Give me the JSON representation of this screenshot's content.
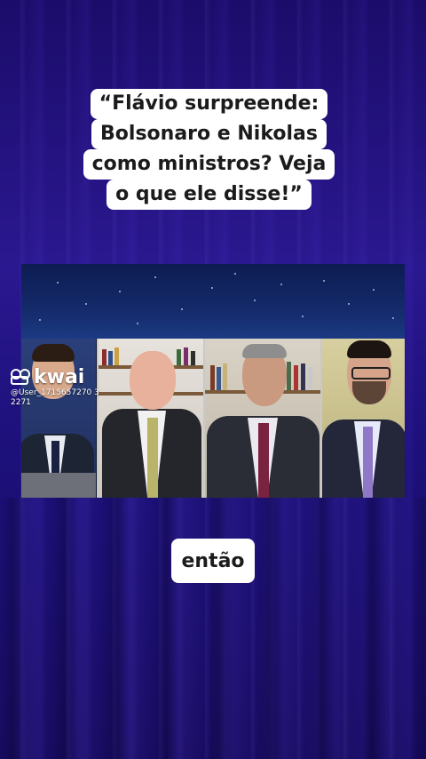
{
  "caption": {
    "lines": [
      "“Flávio surpreende:",
      "Bolsonaro e Nikolas",
      "como ministros? Veja",
      "o que ele disse!”"
    ]
  },
  "watermark": {
    "brand": "kwai",
    "user_handle": "@User_1715657270 3\n2271"
  },
  "subtitle": {
    "text": "então"
  },
  "colors": {
    "background": "#1a0f6e",
    "caption_bg": "#ffffff",
    "caption_text": "#1b1b1b"
  }
}
